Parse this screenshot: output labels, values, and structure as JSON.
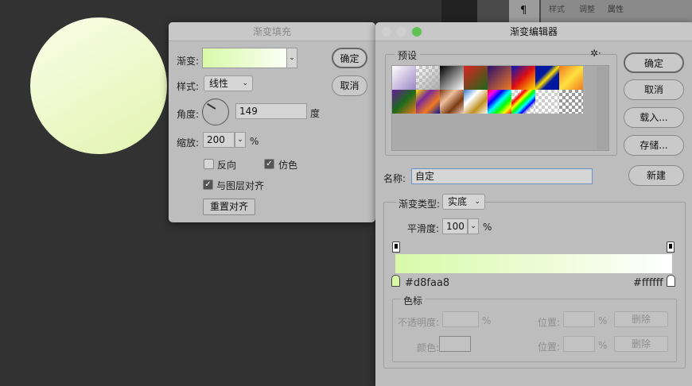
{
  "panel_tabs": [
    "样式",
    "调整",
    "属性"
  ],
  "fill_dialog": {
    "title": "渐变填充",
    "gradient_label": "渐变:",
    "style_label": "样式:",
    "style_value": "线性",
    "angle_label": "角度:",
    "angle_value": "149",
    "angle_unit": "度",
    "scale_label": "缩放:",
    "scale_value": "200",
    "scale_unit": "%",
    "reverse_label": "反向",
    "reverse_checked": false,
    "dither_label": "仿色",
    "dither_checked": true,
    "align_label": "与图层对齐",
    "align_checked": true,
    "reset_align": "重置对齐",
    "ok": "确定",
    "cancel": "取消"
  },
  "editor": {
    "title": "渐变编辑器",
    "presets_label": "预设",
    "ok": "确定",
    "cancel": "取消",
    "load": "载入...",
    "save": "存储...",
    "new": "新建",
    "name_label": "名称:",
    "name_value": "自定",
    "type_label": "渐变类型:",
    "type_value": "实底",
    "smooth_label": "平滑度:",
    "smooth_value": "100",
    "smooth_unit": "%",
    "start_color": "#d8faa8",
    "end_color": "#ffffff",
    "stops_label": "色标",
    "opacity_label": "不透明度:",
    "percent": "%",
    "color_label": "颜色:",
    "location_label": "位置:",
    "delete_label": "删除"
  },
  "colors": {
    "gradient_start": "#d8faa8",
    "gradient_end": "#ffffff"
  }
}
